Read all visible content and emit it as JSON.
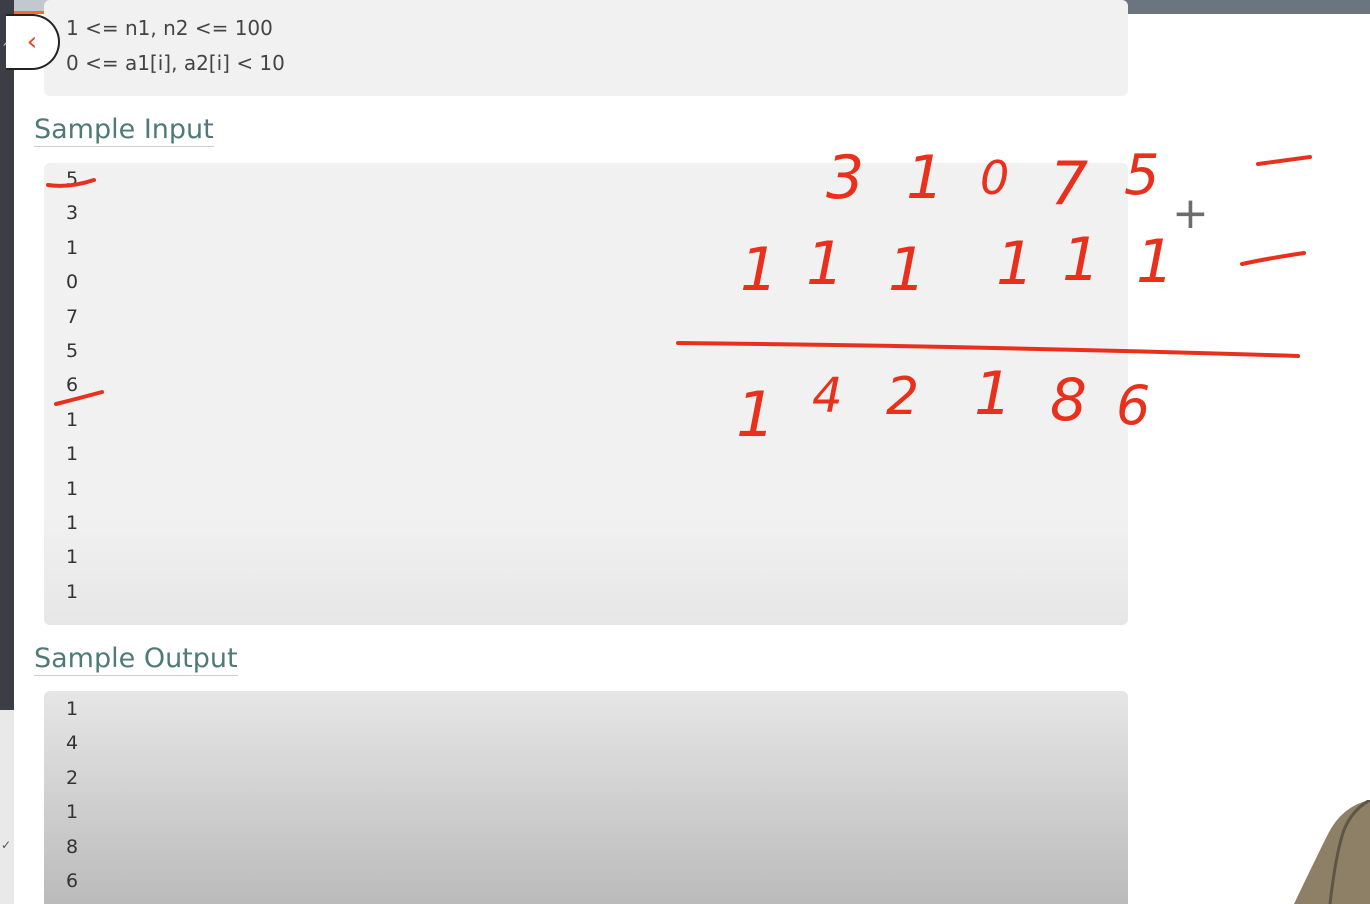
{
  "constraints": [
    "1 <= n1, n2 <= 100",
    "0 <= a1[i], a2[i] < 10"
  ],
  "sample_input": {
    "heading": "Sample Input",
    "lines": [
      "5",
      "3",
      "1",
      "0",
      "7",
      "5",
      "6",
      "1",
      "1",
      "1",
      "1",
      "1",
      "1"
    ]
  },
  "sample_output": {
    "heading": "Sample Output",
    "lines": [
      "1",
      "4",
      "2",
      "1",
      "8",
      "6"
    ]
  },
  "whiteboard": {
    "row1": [
      "3",
      "1",
      "0",
      "7",
      "5"
    ],
    "row2": [
      "1",
      "1",
      "1",
      "1",
      "1",
      "1"
    ],
    "result": [
      "1",
      "4",
      "2",
      "1",
      "8",
      "6"
    ],
    "operator": "+"
  },
  "colors": {
    "ink": "#e8301c",
    "heading": "#4f7a78",
    "accent": "#ff6a2b"
  },
  "icons": {
    "back": "chevron-left-icon"
  }
}
